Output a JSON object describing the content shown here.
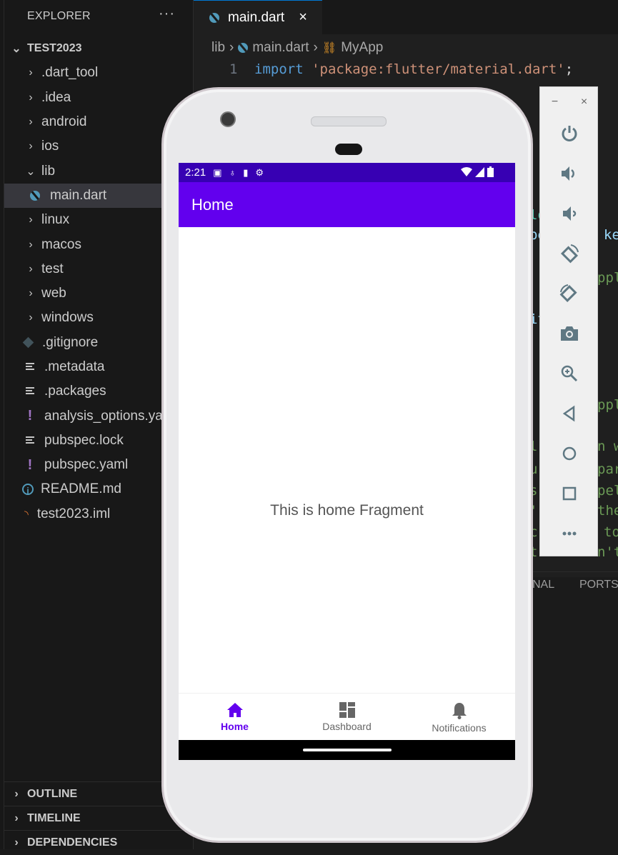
{
  "explorer": {
    "header": "EXPLORER",
    "more_icon": "ellipsis-icon",
    "project": "TEST2023",
    "items": [
      {
        "label": ".dart_tool",
        "type": "folder",
        "expanded": false
      },
      {
        "label": ".idea",
        "type": "folder",
        "expanded": false
      },
      {
        "label": "android",
        "type": "folder",
        "expanded": false
      },
      {
        "label": "ios",
        "type": "folder",
        "expanded": false
      },
      {
        "label": "lib",
        "type": "folder",
        "expanded": true
      },
      {
        "label": "main.dart",
        "type": "dart-file",
        "selected": true
      },
      {
        "label": "linux",
        "type": "folder",
        "expanded": false
      },
      {
        "label": "macos",
        "type": "folder",
        "expanded": false
      },
      {
        "label": "test",
        "type": "folder",
        "expanded": false
      },
      {
        "label": "web",
        "type": "folder",
        "expanded": false
      },
      {
        "label": "windows",
        "type": "folder",
        "expanded": false
      },
      {
        "label": ".gitignore",
        "type": "git-file"
      },
      {
        "label": ".metadata",
        "type": "text-file"
      },
      {
        "label": ".packages",
        "type": "text-file"
      },
      {
        "label": "analysis_options.yaml",
        "type": "yaml-file"
      },
      {
        "label": "pubspec.lock",
        "type": "text-file"
      },
      {
        "label": "pubspec.yaml",
        "type": "yaml-file"
      },
      {
        "label": "README.md",
        "type": "info-file"
      },
      {
        "label": "test2023.iml",
        "type": "rss-file"
      }
    ],
    "sections": [
      "OUTLINE",
      "TIMELINE",
      "DEPENDENCIES"
    ]
  },
  "editor": {
    "tab": {
      "label": "main.dart",
      "close": "×"
    },
    "breadcrumb": [
      "lib",
      "main.dart",
      "MyApp"
    ],
    "line1": {
      "number": "1",
      "keyword": "import",
      "string": "'package:flutter/material.dart'",
      "end": ";"
    },
    "fragments": [
      "lo",
      "pe",
      "ke",
      "ppl",
      "it",
      "ppl",
      "l",
      "n w",
      "u",
      "par",
      "s",
      "pel",
      "'",
      "the",
      "c",
      "to",
      "t",
      "n't"
    ],
    "panel_tabs": [
      "NAL",
      "PORTS"
    ]
  },
  "phone": {
    "status": {
      "time": "2:21"
    },
    "appbar_title": "Home",
    "content": "This is home Fragment",
    "nav": [
      {
        "label": "Home",
        "icon": "home-icon",
        "active": true
      },
      {
        "label": "Dashboard",
        "icon": "dashboard-icon",
        "active": false
      },
      {
        "label": "Notifications",
        "icon": "bell-icon",
        "active": false
      }
    ],
    "colors": {
      "primary": "#6200ee",
      "primary_dark": "#3700b3"
    }
  },
  "emulator_controls": {
    "minimize": "−",
    "close": "×",
    "buttons": [
      "power",
      "volume-up",
      "volume-down",
      "rotate-left",
      "rotate-right",
      "screenshot",
      "zoom",
      "back",
      "home",
      "overview",
      "more"
    ]
  }
}
